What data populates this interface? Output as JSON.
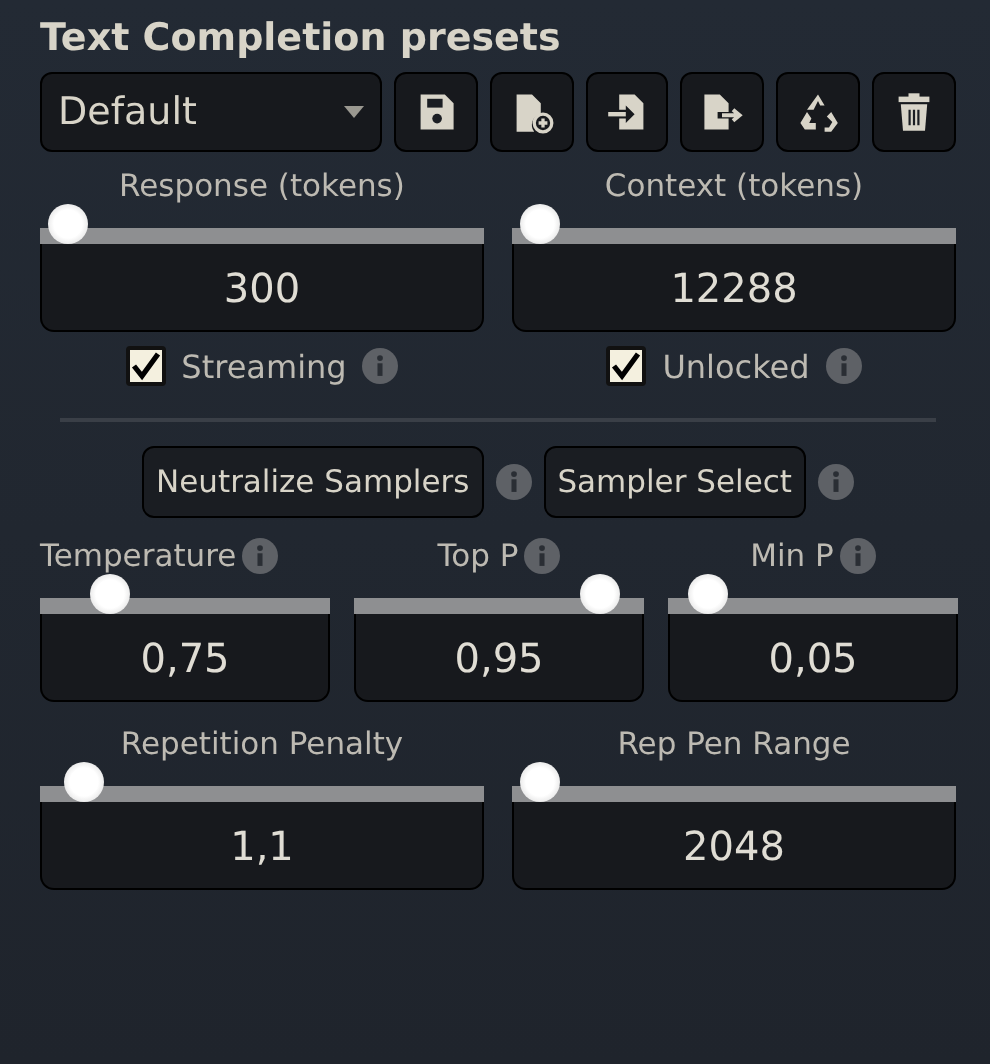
{
  "title": "Text Completion presets",
  "preset": {
    "value": "Default"
  },
  "top_sliders": [
    {
      "label": "Response (tokens)",
      "info": false,
      "level": 0.02,
      "value": "300"
    },
    {
      "label": "Context (tokens)",
      "info": false,
      "level": 0.02,
      "value": "12288"
    }
  ],
  "checkboxes": [
    {
      "label": "Streaming",
      "checked": true,
      "info": true
    },
    {
      "label": "Unlocked",
      "checked": true,
      "info": true
    }
  ],
  "buttons": [
    {
      "label": "Neutralize Samplers",
      "info": true
    },
    {
      "label": "Sampler Select",
      "info": true
    }
  ],
  "sampler_sliders": [
    {
      "label": "Temperature",
      "info": true,
      "level": 0.2,
      "value": "0,75"
    },
    {
      "label": "Top P",
      "info": true,
      "level": 0.9,
      "value": "0,95"
    },
    {
      "label": "Min P",
      "info": true,
      "level": 0.08,
      "value": "0,05"
    }
  ],
  "bottom_sliders": [
    {
      "label": "Repetition Penalty",
      "info": false,
      "level": 0.06,
      "value": "1,1"
    },
    {
      "label": "Rep Pen Range",
      "info": false,
      "level": 0.02,
      "value": "2048"
    }
  ]
}
